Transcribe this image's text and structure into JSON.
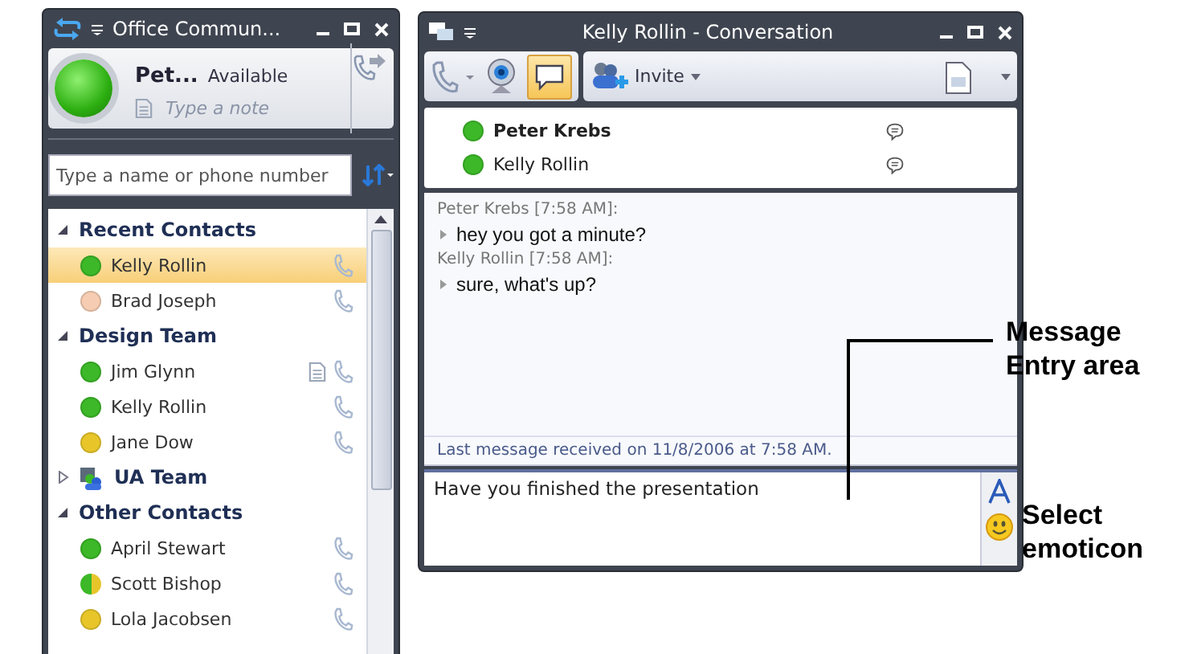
{
  "contacts_window": {
    "title": "Office Commun...",
    "me": {
      "name": "Pet...",
      "status": "Available",
      "note": {
        "placeholder": "Type a note"
      }
    },
    "search": {
      "placeholder": "Type a name or phone number"
    },
    "groups": [
      {
        "name": "Recent Contacts",
        "kind": "group",
        "expanded": true,
        "children": [
          {
            "name": "Kelly Rollin",
            "color": "#3cb828",
            "selected": true,
            "note": false
          },
          {
            "name": "Brad Joseph",
            "color": "#f6cdb2",
            "selected": false,
            "note": false
          }
        ]
      },
      {
        "name": "Design Team",
        "kind": "group",
        "expanded": true,
        "children": [
          {
            "name": "Jim Glynn",
            "color": "#3cb828",
            "selected": false,
            "note": true
          },
          {
            "name": "Kelly Rollin",
            "color": "#3cb828",
            "selected": false,
            "note": false
          },
          {
            "name": "Jane Dow",
            "color": "#e8c62a",
            "selected": false,
            "note": false
          }
        ]
      },
      {
        "name": "UA Team",
        "kind": "team",
        "expanded": false
      },
      {
        "name": "Other Contacts",
        "kind": "group",
        "expanded": true,
        "children": [
          {
            "name": "April Stewart",
            "color": "#3cb828",
            "selected": false,
            "note": false
          },
          {
            "name": "Scott Bishop",
            "halves": [
              {
                "color": "#3cb828"
              },
              {
                "color": "#e8c62a"
              }
            ],
            "selected": false,
            "note": false
          },
          {
            "name": "Lola Jacobsen",
            "color": "#e8c62a",
            "selected": false,
            "note": false
          }
        ]
      }
    ]
  },
  "conversation_window": {
    "title": "Kelly Rollin - Conversation",
    "toolbar": {
      "invite": "Invite",
      "im_selected": true
    },
    "participants": [
      {
        "name": "Peter Krebs",
        "color": "#3cb828",
        "bold": true
      },
      {
        "name": "Kelly Rollin",
        "color": "#3cb828",
        "bold": false
      }
    ],
    "messages": [
      {
        "sender": "Peter Krebs [7:58 AM]:",
        "text": "hey you got a minute?"
      },
      {
        "sender": "Kelly Rollin [7:58 AM]:",
        "text": "sure, what's up?"
      }
    ],
    "status_line": "Last message received on 11/8/2006 at 7:58 AM.",
    "input": {
      "value": "Have you finished the presentation"
    }
  },
  "annotations": [
    {
      "kind": "entry",
      "lines": [
        "Message",
        "Entry area"
      ]
    },
    {
      "kind": "emoticon",
      "lines": [
        "Select",
        "emoticon"
      ]
    }
  ]
}
